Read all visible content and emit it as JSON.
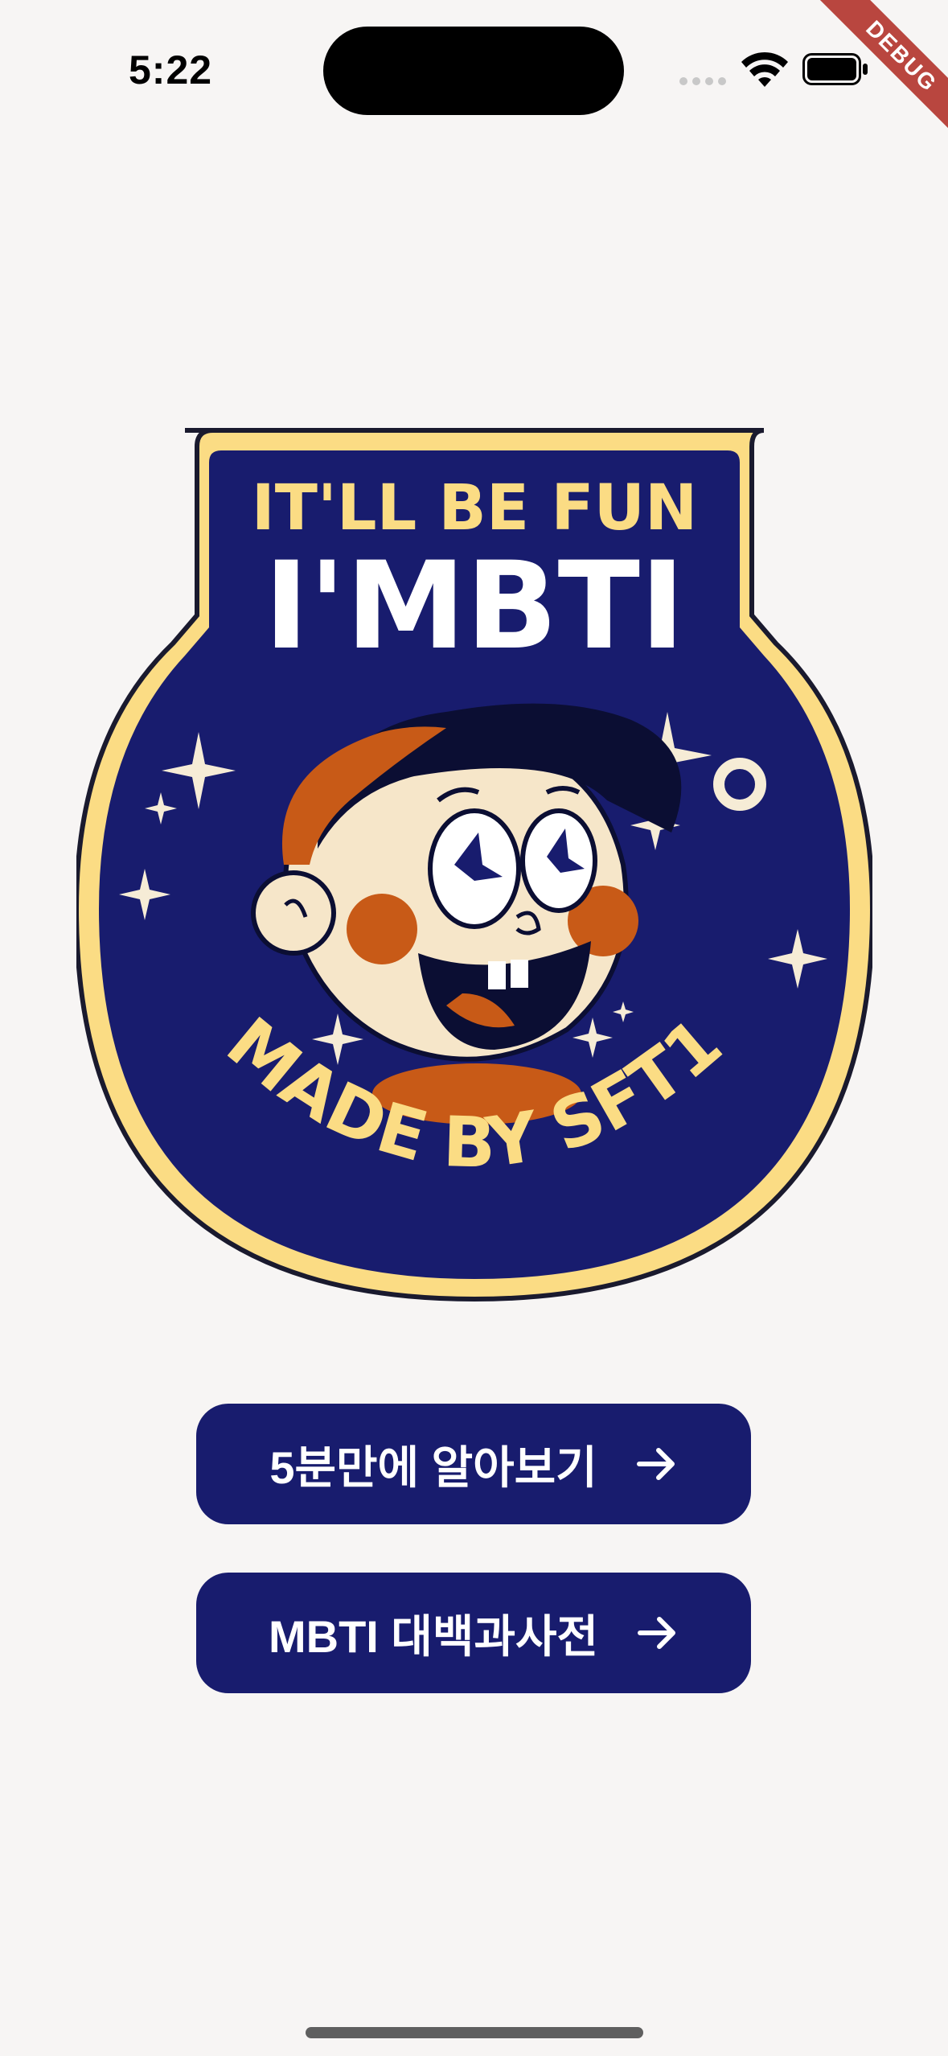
{
  "status_bar": {
    "time": "5:22"
  },
  "debug_banner": {
    "label": "DEBUG"
  },
  "badge": {
    "top_text": "IT'LL BE FUN",
    "title": "I'MBTI",
    "bottom_text": "MADE BY SFT1",
    "colors": {
      "navy": "#181c6e",
      "yellow": "#fbdc84",
      "orange": "#c85a17",
      "cream": "#f6e6c9",
      "dark": "#0b0e33"
    }
  },
  "buttons": [
    {
      "label": "5분만에 알아보기",
      "icon": "arrow-right-icon"
    },
    {
      "label": "MBTI 대백과사전",
      "icon": "arrow-right-icon"
    }
  ],
  "theme": {
    "background": "#f7f5f4",
    "button_color": "#181c6e"
  }
}
